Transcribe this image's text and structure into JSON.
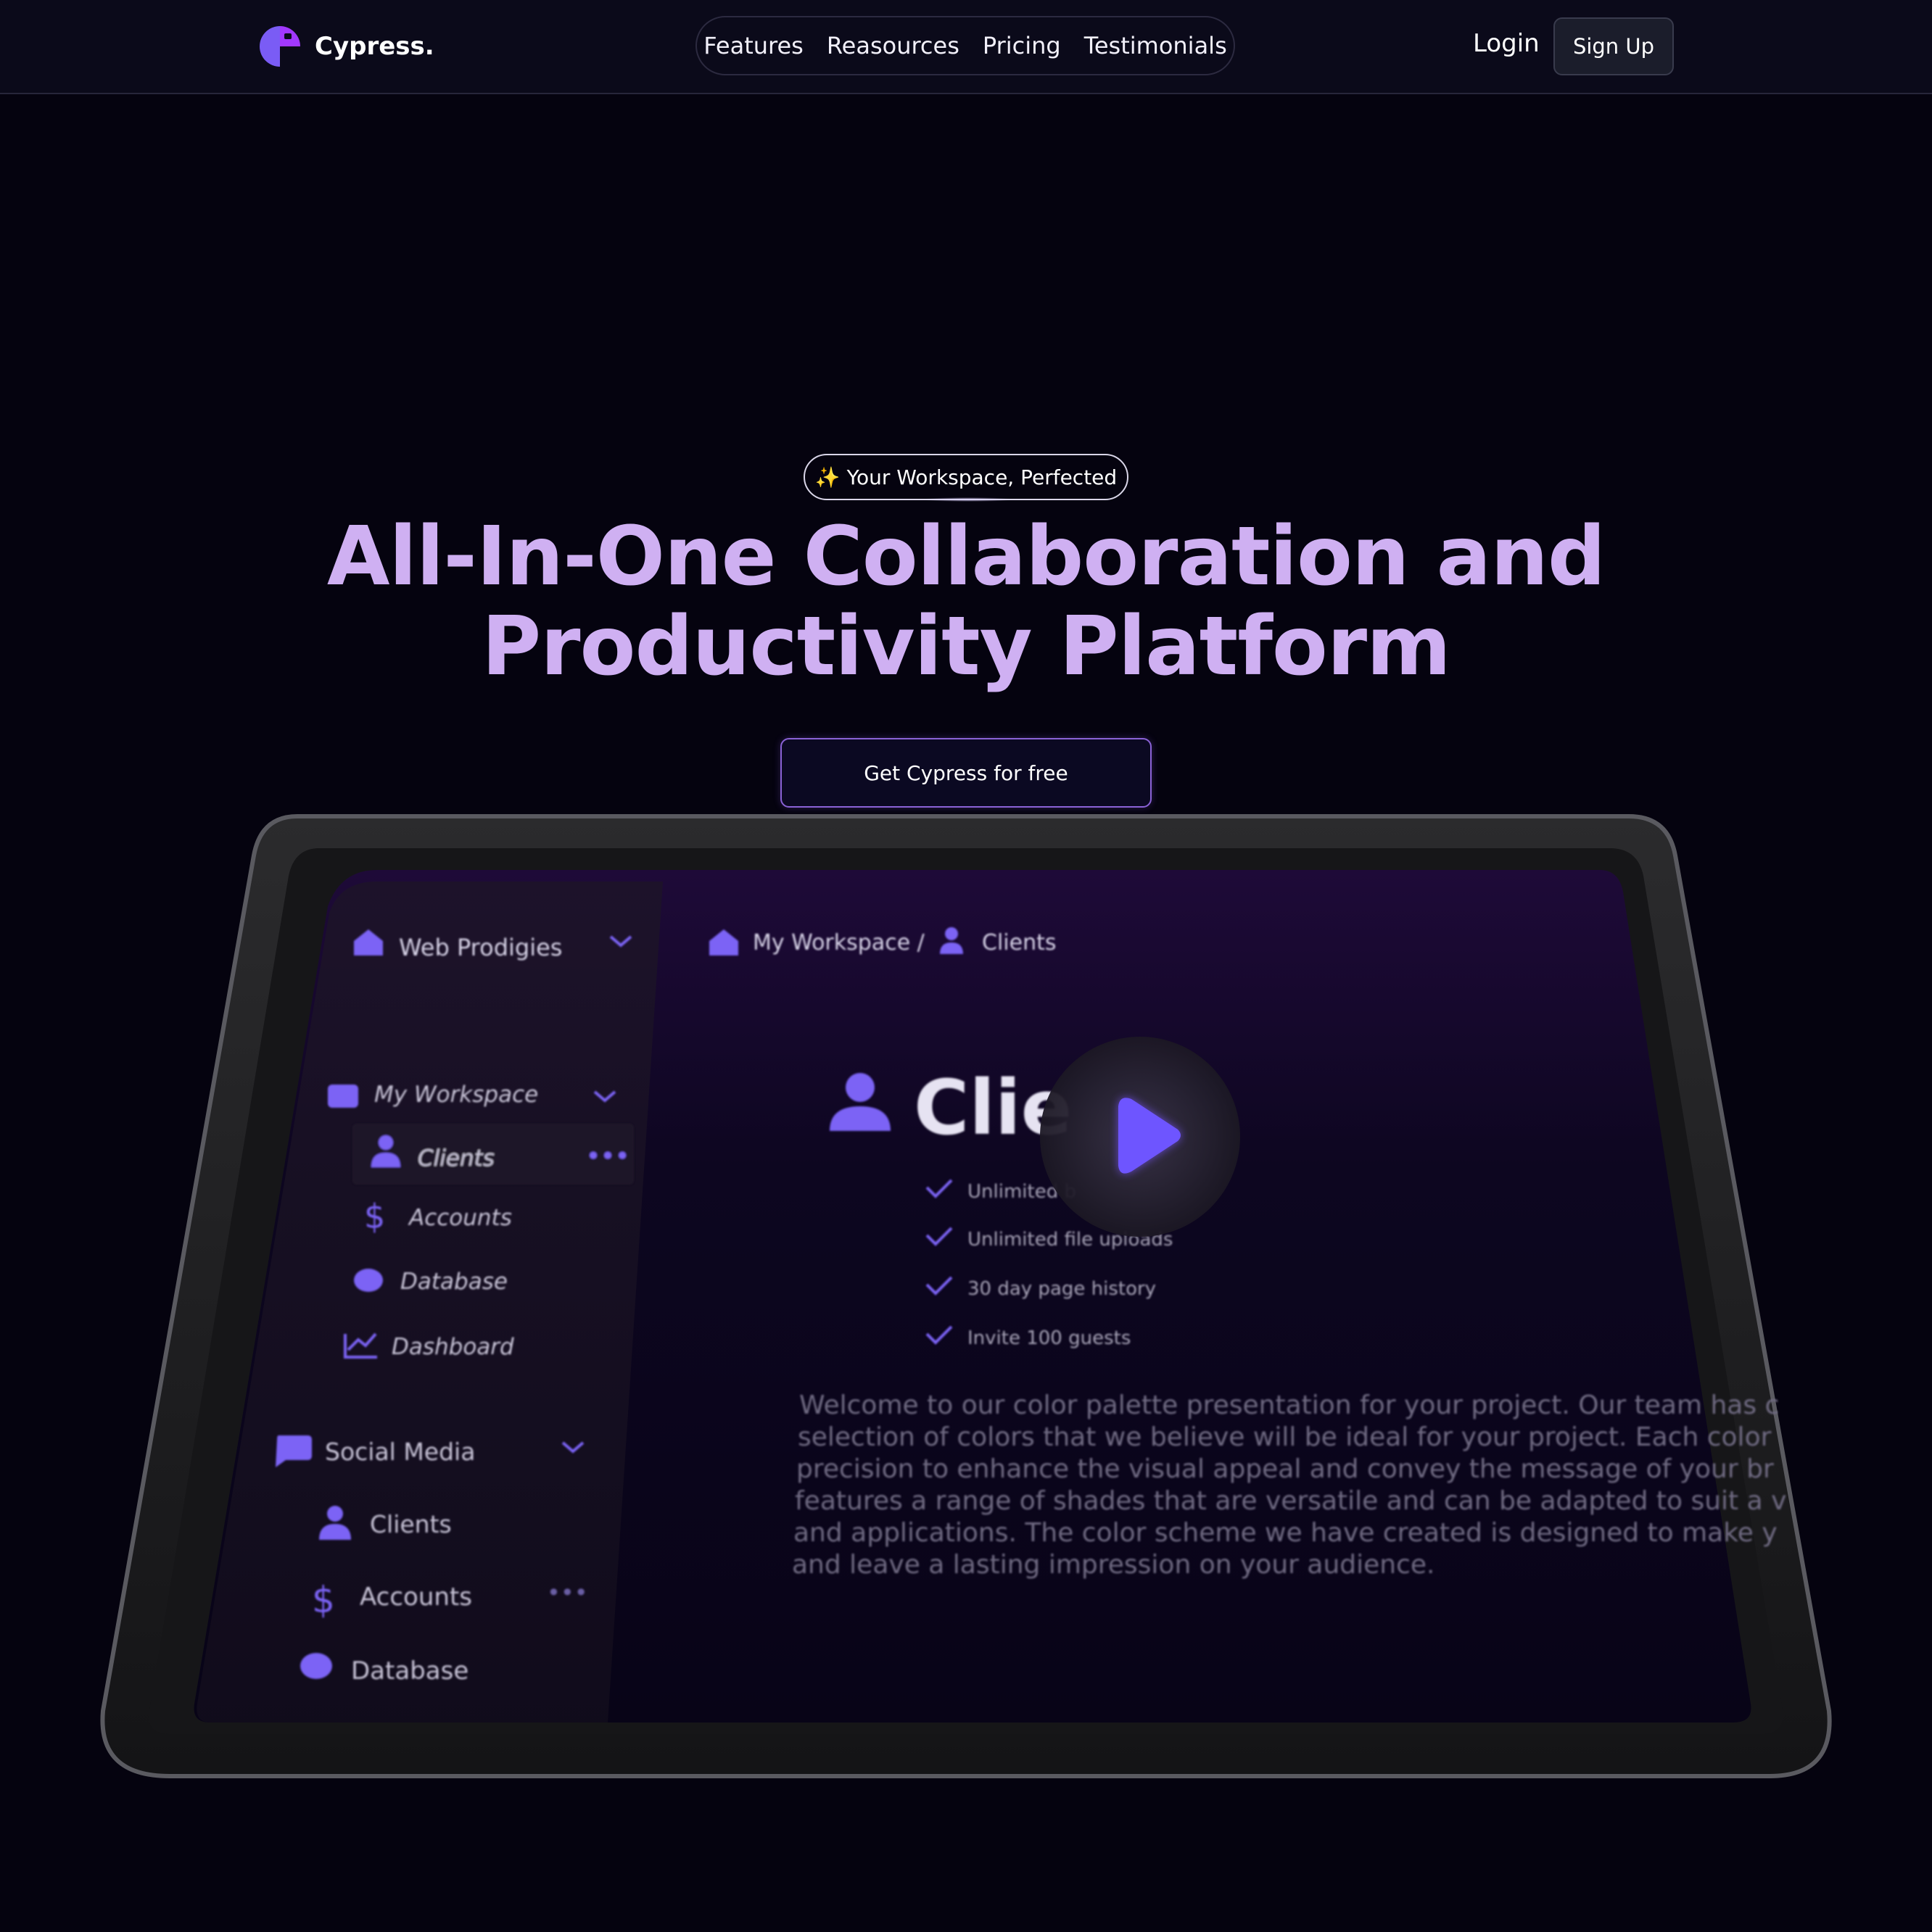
{
  "header": {
    "brand": "Cypress.",
    "nav": [
      "Features",
      "Reasources",
      "Pricing",
      "Testimonials"
    ],
    "login": "Login",
    "signup": "Sign Up"
  },
  "hero": {
    "badge": "✨ Your Workspace, Perfected",
    "title_line1": "All-In-One Collaboration and",
    "title_line2": "Productivity Platform",
    "cta": "Get Cypress for free"
  },
  "preview": {
    "workspace_switcher": "Web Prodigies",
    "breadcrumb_root": "My Workspace /",
    "breadcrumb_leaf": "Clients",
    "sidebar": {
      "section1_title": "My Workspace",
      "section1_items": [
        "Clients",
        "Accounts",
        "Database",
        "Dashboard"
      ],
      "section2_title": "Social Media",
      "section2_items": [
        "Clients",
        "Accounts",
        "Database"
      ]
    },
    "page_title": "Clie",
    "features": [
      "Unlimited b",
      "Unlimited file uploads",
      "30 day page history",
      "Invite 100 guests"
    ],
    "paragraph": [
      "Welcome to our color palette presentation for your project. Our team has c",
      "selection of colors that we believe will be ideal for your project. Each color",
      "precision to enhance the visual appeal and convey the message of your br",
      "features a range of shades that are versatile and can be adapted to suit a v",
      "and applications. The color scheme we have created is designed to make y",
      "and leave a lasting impression on your audience."
    ]
  },
  "colors": {
    "background": "#05030f",
    "header_bg": "#0b0a1a",
    "title": "#cfb0f2",
    "accent": "#7b5cff",
    "button_border": "#8a62d6"
  },
  "icons": {
    "logo": "cypress-logo-icon",
    "play": "play-icon",
    "home": "home-icon",
    "user": "user-icon",
    "dollar": "dollar-icon",
    "database": "database-icon",
    "chart": "chart-icon",
    "chat": "chat-icon",
    "chevron": "chevron-down-icon",
    "more": "more-icon",
    "check": "check-icon"
  }
}
